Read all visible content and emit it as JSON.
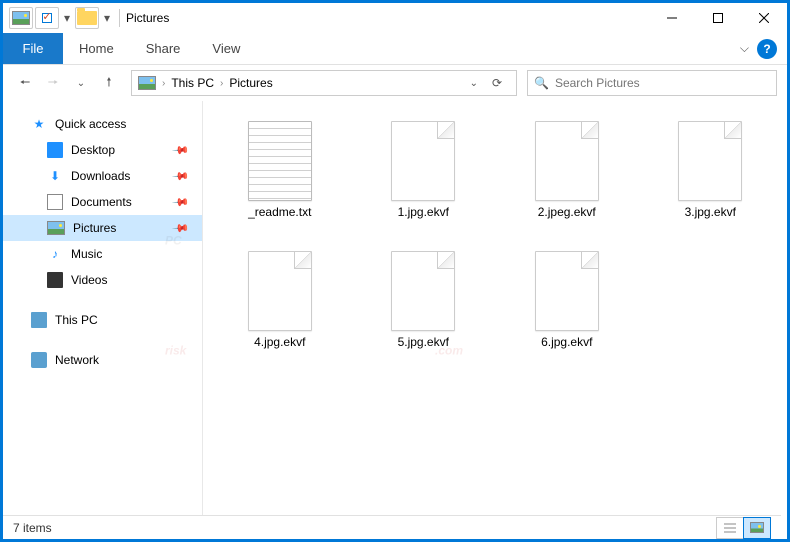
{
  "window": {
    "title": "Pictures"
  },
  "ribbon": {
    "file": "File",
    "tabs": [
      "Home",
      "Share",
      "View"
    ]
  },
  "breadcrumb": {
    "items": [
      "This PC",
      "Pictures"
    ]
  },
  "search": {
    "placeholder": "Search Pictures"
  },
  "sidebar": {
    "quick_access": "Quick access",
    "pinned": [
      {
        "label": "Desktop",
        "icon": "desktop"
      },
      {
        "label": "Downloads",
        "icon": "downloads"
      },
      {
        "label": "Documents",
        "icon": "documents"
      },
      {
        "label": "Pictures",
        "icon": "pictures",
        "selected": true
      }
    ],
    "misc": [
      {
        "label": "Music",
        "icon": "music"
      },
      {
        "label": "Videos",
        "icon": "videos"
      }
    ],
    "this_pc": "This PC",
    "network": "Network"
  },
  "files": [
    {
      "name": "_readme.txt",
      "kind": "text"
    },
    {
      "name": "1.jpg.ekvf",
      "kind": "blank"
    },
    {
      "name": "2.jpeg.ekvf",
      "kind": "blank"
    },
    {
      "name": "3.jpg.ekvf",
      "kind": "blank"
    },
    {
      "name": "4.jpg.ekvf",
      "kind": "blank"
    },
    {
      "name": "5.jpg.ekvf",
      "kind": "blank"
    },
    {
      "name": "6.jpg.ekvf",
      "kind": "blank"
    }
  ],
  "status": {
    "count": "7 items"
  }
}
